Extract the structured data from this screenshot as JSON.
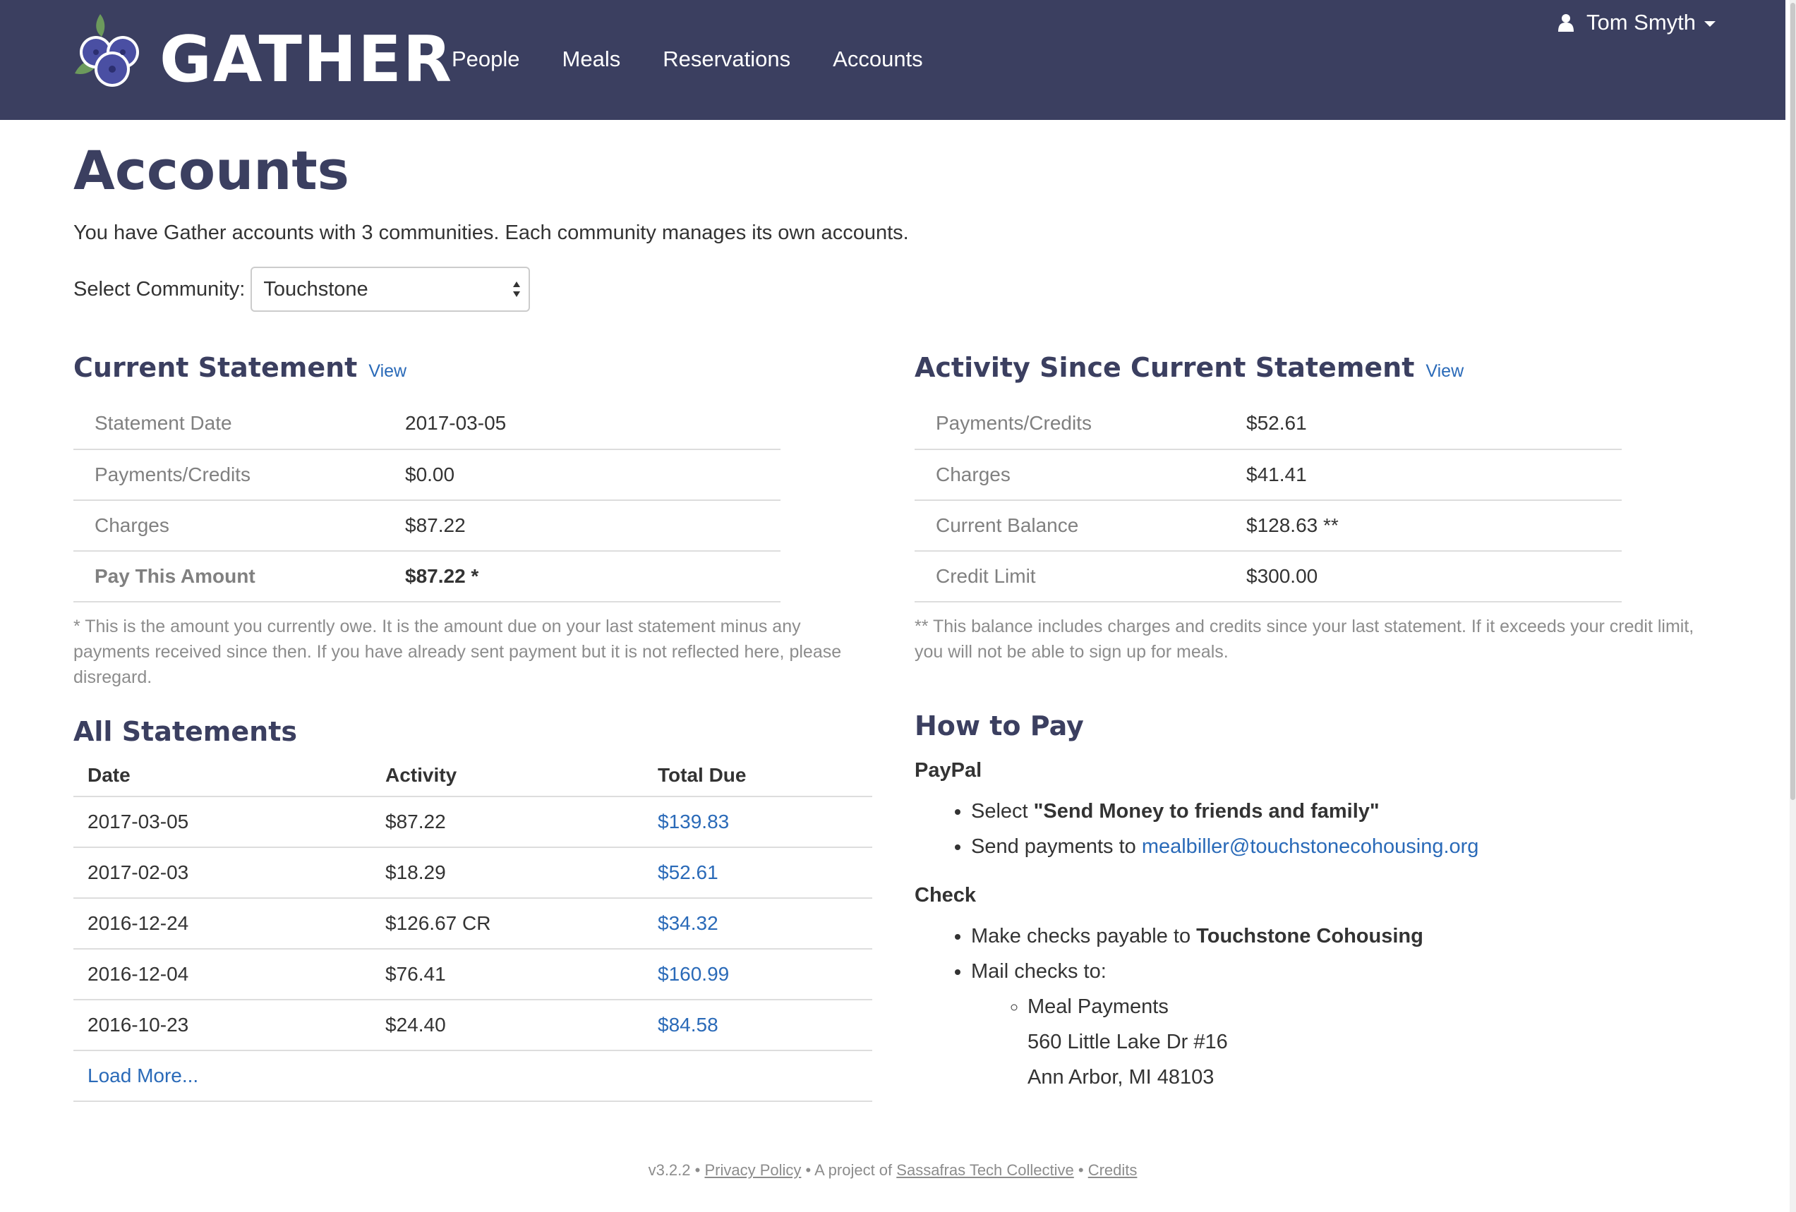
{
  "brand": {
    "name": "GATHER"
  },
  "nav": {
    "items": [
      "People",
      "Meals",
      "Reservations",
      "Accounts"
    ]
  },
  "user": {
    "name": "Tom Smyth",
    "icon": "user-icon"
  },
  "page": {
    "title": "Accounts",
    "intro": "You have Gather accounts with 3 communities. Each community manages its own accounts.",
    "select_label": "Select Community:",
    "select_value": "Touchstone"
  },
  "current_statement": {
    "heading": "Current Statement",
    "view_label": "View",
    "rows": [
      {
        "label": "Statement Date",
        "value": "2017-03-05"
      },
      {
        "label": "Payments/Credits",
        "value": "$0.00"
      },
      {
        "label": "Charges",
        "value": "$87.22"
      },
      {
        "label": "Pay This Amount",
        "value": "$87.22",
        "marker": "*"
      }
    ],
    "note": "* This is the amount you currently owe. It is the amount due on your last statement minus any payments received since then. If you have already sent payment but it is not reflected here, please disregard."
  },
  "activity": {
    "heading": "Activity Since Current Statement",
    "view_label": "View",
    "rows": [
      {
        "label": "Payments/Credits",
        "value": "$52.61"
      },
      {
        "label": "Charges",
        "value": "$41.41"
      },
      {
        "label": "Current Balance",
        "value": "$128.63",
        "marker": "**"
      },
      {
        "label": "Credit Limit",
        "value": "$300.00"
      }
    ],
    "note": "** This balance includes charges and credits since your last statement. If it exceeds your credit limit, you will not be able to sign up for meals."
  },
  "all_statements": {
    "heading": "All Statements",
    "columns": [
      "Date",
      "Activity",
      "Total Due"
    ],
    "rows": [
      {
        "date": "2017-03-05",
        "activity": "$87.22",
        "total": "$139.83"
      },
      {
        "date": "2017-02-03",
        "activity": "$18.29",
        "total": "$52.61"
      },
      {
        "date": "2016-12-24",
        "activity": "$126.67 CR",
        "total": "$34.32"
      },
      {
        "date": "2016-12-04",
        "activity": "$76.41",
        "total": "$160.99"
      },
      {
        "date": "2016-10-23",
        "activity": "$24.40",
        "total": "$84.58"
      }
    ],
    "load_more": "Load More..."
  },
  "how_to_pay": {
    "heading": "How to Pay",
    "paypal": {
      "title": "PayPal",
      "select_prefix": "Select ",
      "select_bold": "\"Send Money to friends and family\"",
      "send_prefix": "Send payments to ",
      "email": "mealbiller@touchstonecohousing.org"
    },
    "check": {
      "title": "Check",
      "payable_prefix": "Make checks payable to ",
      "payable_bold": "Touchstone Cohousing",
      "mail_label": "Mail checks to:",
      "address": [
        "Meal Payments",
        "560 Little Lake Dr #16",
        "Ann Arbor, MI 48103"
      ]
    }
  },
  "footer": {
    "version": "v3.2.2",
    "sep": " • ",
    "privacy": "Privacy Policy",
    "project_prefix": "A project of ",
    "collective": "Sassafras Tech Collective",
    "credits": "Credits"
  },
  "colors": {
    "navbar": "#3b3f60",
    "heading": "#3b3f60",
    "link": "#2a6ab8"
  }
}
